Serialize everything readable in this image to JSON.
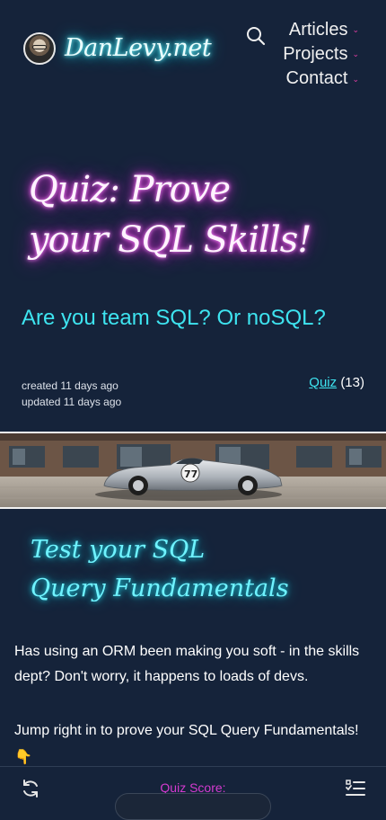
{
  "header": {
    "site_title": "DanLevy.net",
    "nav": [
      {
        "label": "Articles"
      },
      {
        "label": "Projects"
      },
      {
        "label": "Contact"
      }
    ]
  },
  "hero": {
    "title_line1": "Quiz: Prove",
    "title_line2": "your SQL Skills!",
    "subtitle": "Are you team SQL? Or noSQL?",
    "created": "created 11 days ago",
    "updated": "updated 11 days ago",
    "tag_label": "Quiz",
    "tag_count": "(13)"
  },
  "section": {
    "title_line1": "Test your SQL",
    "title_line2": "Query Fundamentals",
    "paragraph1": "Has using an ORM been making you soft - in the skills dept? Don't worry, it happens to loads of devs.",
    "paragraph2": "Jump right in to prove your SQL Query Fundamentals!",
    "emoji": "👇"
  },
  "bottom_bar": {
    "score_label": "Quiz Score:"
  },
  "icons": {
    "search": "search-icon",
    "refresh": "refresh-icon",
    "list": "checklist-icon",
    "chevron": "chevron-down-icon"
  },
  "colors": {
    "background": "#15233a",
    "cyan_accent": "#3ee4f0",
    "pink_accent": "#e43fa5",
    "neon_pink": "#f13ce6"
  }
}
